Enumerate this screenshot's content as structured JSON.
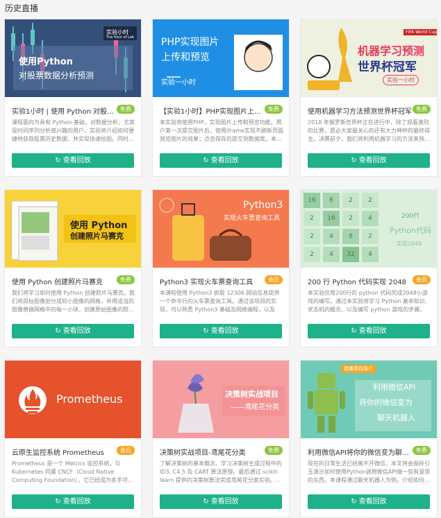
{
  "page": {
    "heading": "历史直播"
  },
  "replay_label": "查看回放",
  "cards": [
    {
      "title": "实验1小时 | 使用 Python 对股票数...",
      "badge": "免费",
      "desc": "课程面向为具有 Python 基础，对数据分析，尤其是时间序列分析感兴趣的用户。实验将介绍如何便捷地获取股票历史数据，并实现快速绘图。同时...",
      "thumb": {
        "line1": "使用Python",
        "line2": "对股票数据分析预测",
        "logo": "实验小时",
        "logo_sub": "The Hour of Lab"
      }
    },
    {
      "title": "【实验1小时】PHP实现图片上传和...",
      "badge": "免费",
      "desc": "本实验将使用PHP，实现图片上传和预览功能。用户第一次提交图片后，使用iframe实现不刷新页面预览图片的效果；点击保存后提交到数据库。本...",
      "thumb": {
        "line1": "PHP实现图片",
        "line2": "上传和预览",
        "line3": "实验一小时"
      }
    },
    {
      "title": "使用机器学习方法预测世界杯冠军",
      "badge": "免费",
      "desc": "2018 年俄罗斯世界杯正在进行中，除了观看激烈的比赛，愿必大家最关心的还有大力神杯的最终得主。决赛前夕，我们将利用机器学习的方法来预...",
      "thumb": {
        "line1": "机器学习预测",
        "line2": "世界杯冠军",
        "line3": "实验一小时",
        "tag": "FIFA World Cup"
      }
    },
    {
      "title": "使用 Python 创建照片马赛克",
      "badge": "免费",
      "desc": "我们将学习如何使用 Python 创建照片马赛克。我们将目标图像划分成较小图像的网格，并用适当的图像替换网格中的每一小块，创建原始图像的照...",
      "thumb": {
        "line1": "使用 Python",
        "line2": "创建照片马赛克"
      }
    },
    {
      "title": "Python3 实现火车票查询工具",
      "badge": "会员",
      "desc": "本课程使用 Python3 抓取 12306 网站信息提供一个命令行的火车票查询工具。通过该项目的实现，可以熟悉 Python3 基础及网络编程，以及 doco...",
      "thumb": {
        "line1": "Python3",
        "line2": "实现火车票查询工具"
      }
    },
    {
      "title": "200 行 Python 代码实现 2048",
      "badge": "会员",
      "desc": "本实验仅用200行的 python 代码完成2048小游戏的编写。通过本实验将学习 Python 基本知识、状态机的概念，以及编写 python 游戏的步骤。为...",
      "thumb": {
        "line1": "200行",
        "line2": "Python代码",
        "line3": "实现2048",
        "tiles": [
          "16",
          "8",
          "2",
          "2",
          "2",
          "16",
          "2",
          "4",
          "2",
          "4",
          "8",
          "2",
          "2",
          "4",
          "32",
          "4"
        ]
      }
    },
    {
      "title": "云原生监控系统 Prometheus",
      "badge": "会员",
      "desc": "Prometheus 是一个 Metrics 监控系统，与 Kubernetes 同属 CNCF（Cloud Native Computing Foundation），它已经成为炙手可...",
      "thumb": {
        "line1": "Prometheus"
      }
    },
    {
      "title": "决策树实战项目-鸢尾花分类",
      "badge": "免费",
      "desc": "了解决策树的基本概念、学习决策树生成过程中的 ID3, C4.5 及 CART 算法原理。最后通过 scikit-learn 提供的决策树算法完成鸢尾花分类实验。...",
      "thumb": {
        "line1": "决策树实战项目",
        "line2": "——鸢尾花分类"
      }
    },
    {
      "title": "利用微信API将你的微信变为聊天机...",
      "badge": "免费",
      "desc": "现在的日常生活已经离不开微信，本文将会抛砖引玉演示如何使用Python调用微信API做一些有意思的东西。本课程通过聊天机器人为例，介绍如何...",
      "thumb": {
        "line1": "利用微信API",
        "line2": "将你的微信变为",
        "line3": "聊天机器人",
        "tag": "楼赛项目简介"
      }
    }
  ]
}
